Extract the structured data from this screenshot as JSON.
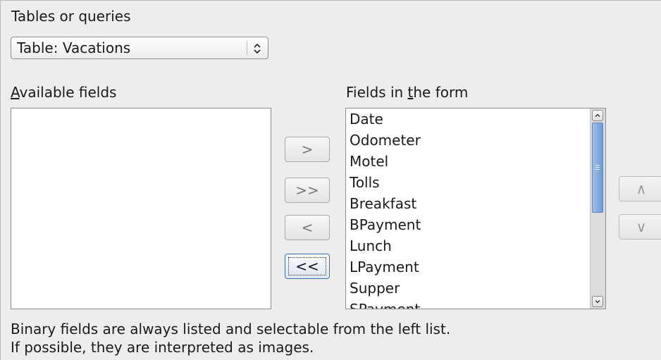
{
  "tables_label": "Tables or queries",
  "table_select": {
    "value": "Table: Vacations"
  },
  "available_label": {
    "underline": "A",
    "rest": "vailable fields"
  },
  "form_fields_label": {
    "before": "Fields in ",
    "underline": "t",
    "after": "he form"
  },
  "available_fields": [],
  "form_fields": [
    "Date",
    "Odometer",
    "Motel",
    "Tolls",
    "Breakfast",
    "BPayment",
    "Lunch",
    "LPayment",
    "Supper",
    "SPayment"
  ],
  "buttons": {
    "move_selected_right": ">",
    "move_all_right": ">>",
    "move_selected_left": "<",
    "move_all_left": "<<",
    "move_up": "∧",
    "move_down": "∨"
  },
  "info_line1": "Binary fields are always listed and selectable from the left list.",
  "info_line2": "If possible, they are interpreted as images."
}
